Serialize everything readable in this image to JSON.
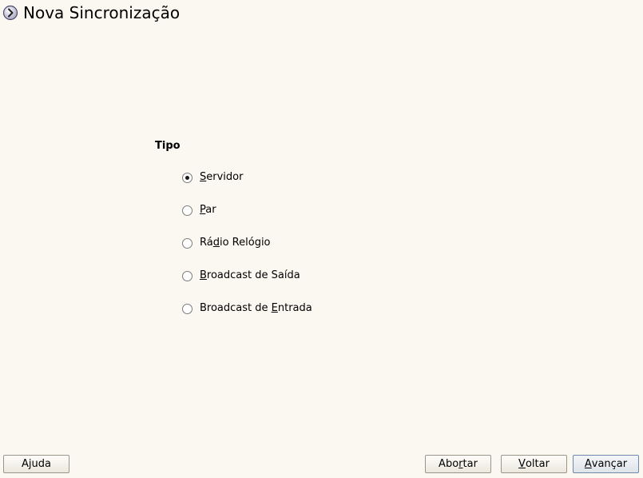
{
  "header": {
    "title": "Nova Sincronização",
    "icon": "arrow-circle-icon"
  },
  "type_group": {
    "label": "Tipo",
    "selected": "Servidor",
    "options": [
      {
        "pre": "",
        "mnemonic": "S",
        "post": "ervidor",
        "checked": true
      },
      {
        "pre": "",
        "mnemonic": "P",
        "post": "ar",
        "checked": false
      },
      {
        "pre": "Rá",
        "mnemonic": "d",
        "post": "io Relógio",
        "checked": false
      },
      {
        "pre": "",
        "mnemonic": "B",
        "post": "roadcast de Saída",
        "checked": false
      },
      {
        "pre": "Broadcast de ",
        "mnemonic": "E",
        "post": "ntrada",
        "checked": false
      }
    ]
  },
  "buttons": {
    "help": {
      "pre": "Ajuda",
      "mnemonic": "",
      "post": ""
    },
    "abort": {
      "pre": "Abo",
      "mnemonic": "r",
      "post": "tar"
    },
    "back": {
      "pre": "",
      "mnemonic": "V",
      "post": "oltar"
    },
    "next": {
      "pre": "",
      "mnemonic": "A",
      "post": "vançar"
    }
  },
  "colors": {
    "background": "#fbf8f1",
    "button_border": "#9a958a",
    "default_button_border": "#6f8aa8"
  }
}
